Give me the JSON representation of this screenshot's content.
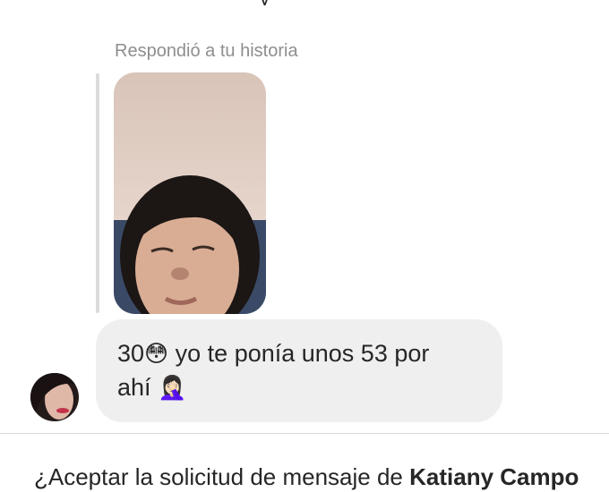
{
  "thread": {
    "top_partial_text": "y",
    "reply_label": "Respondió a tu historia",
    "message": {
      "text_before_emoji": "30",
      "emoji_flushed": "😳",
      "text_after_emoji": " yo te ponía unos 53 por",
      "line2_text": "ahí ",
      "emoji_facepalm": "🤦🏻‍♀️"
    }
  },
  "request_prompt": {
    "prefix": "¿Aceptar la solicitud de mensaje de ",
    "sender_name": "Katiany Campo"
  },
  "colors": {
    "bubble_bg": "#efefef",
    "secondary_text": "#8e8e8e",
    "primary_text": "#262626",
    "divider": "#dbdbdb"
  }
}
